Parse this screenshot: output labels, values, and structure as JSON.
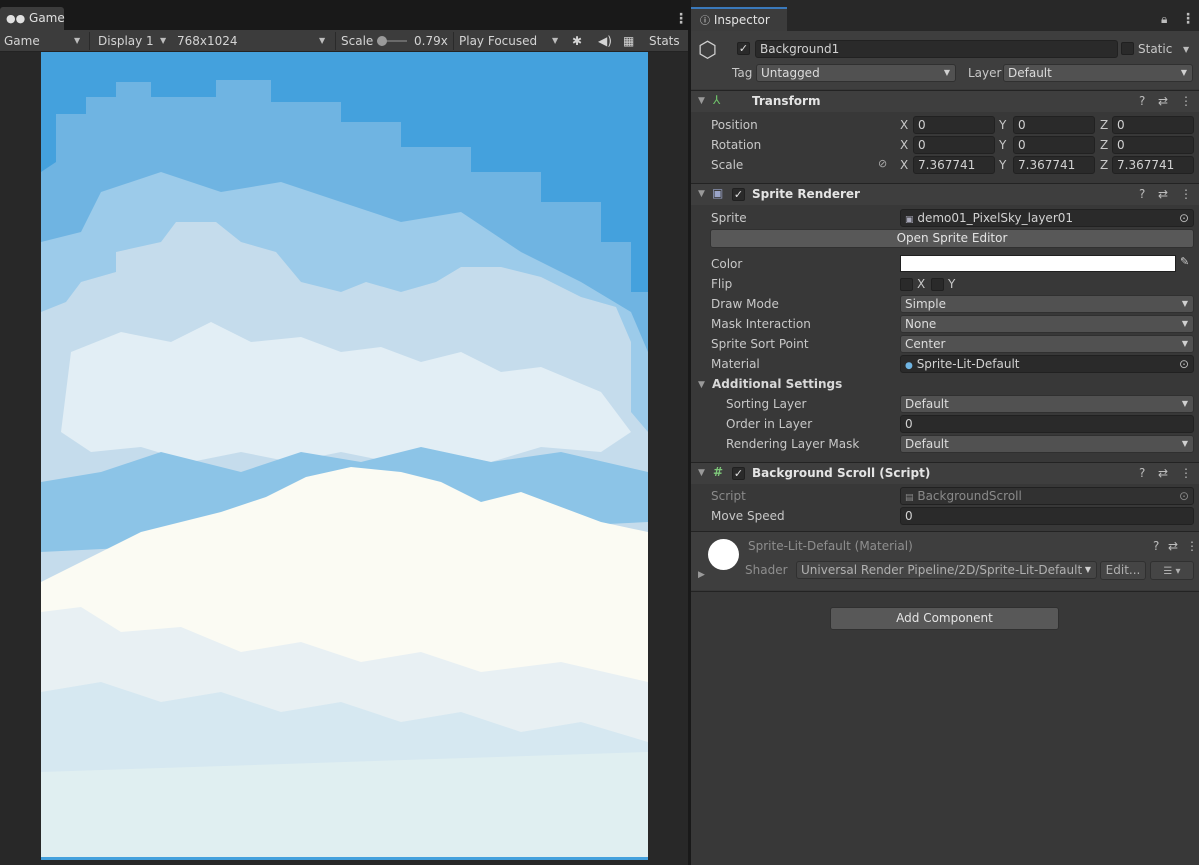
{
  "game": {
    "tab_label": "Game",
    "mode": "Game",
    "display": "Display 1",
    "resolution": "768x1024",
    "scale_label": "Scale",
    "scale_value": "0.79x",
    "play_mode": "Play Focused",
    "stats_label": "Stats"
  },
  "inspector": {
    "tab_label": "Inspector",
    "object": {
      "name": "Background1",
      "static_label": "Static",
      "tag_label": "Tag",
      "tag_value": "Untagged",
      "layer_label": "Layer",
      "layer_value": "Default"
    },
    "transform": {
      "title": "Transform",
      "position_label": "Position",
      "rotation_label": "Rotation",
      "scale_label": "Scale",
      "position": {
        "x": "0",
        "y": "0",
        "z": "0"
      },
      "rotation": {
        "x": "0",
        "y": "0",
        "z": "0"
      },
      "scale": {
        "x": "7.367741",
        "y": "7.367741",
        "z": "7.367741"
      }
    },
    "sprite_renderer": {
      "title": "Sprite Renderer",
      "sprite_label": "Sprite",
      "sprite_value": "demo01_PixelSky_layer01",
      "open_editor_button": "Open Sprite Editor",
      "color_label": "Color",
      "color_value": "#ffffff",
      "flip_label": "Flip",
      "flip_x": "X",
      "flip_y": "Y",
      "draw_mode_label": "Draw Mode",
      "draw_mode_value": "Simple",
      "mask_label": "Mask Interaction",
      "mask_value": "None",
      "sort_point_label": "Sprite Sort Point",
      "sort_point_value": "Center",
      "material_label": "Material",
      "material_value": "Sprite-Lit-Default",
      "additional_settings_label": "Additional Settings",
      "sorting_layer_label": "Sorting Layer",
      "sorting_layer_value": "Default",
      "order_label": "Order in Layer",
      "order_value": "0",
      "rendering_mask_label": "Rendering Layer Mask",
      "rendering_mask_value": "Default"
    },
    "script": {
      "title": "Background Scroll (Script)",
      "script_label": "Script",
      "script_value": "BackgroundScroll",
      "move_speed_label": "Move Speed",
      "move_speed_value": "0"
    },
    "material": {
      "title": "Sprite-Lit-Default (Material)",
      "shader_label": "Shader",
      "shader_value": "Universal Render Pipeline/2D/Sprite-Lit-Default",
      "edit_button": "Edit..."
    },
    "add_component_button": "Add Component"
  },
  "colors": {
    "sky": "#44a1dd",
    "cloud_white": "#fbfbf3",
    "cloud_blue": "#c5dcec",
    "accent": "#3a79bb"
  }
}
